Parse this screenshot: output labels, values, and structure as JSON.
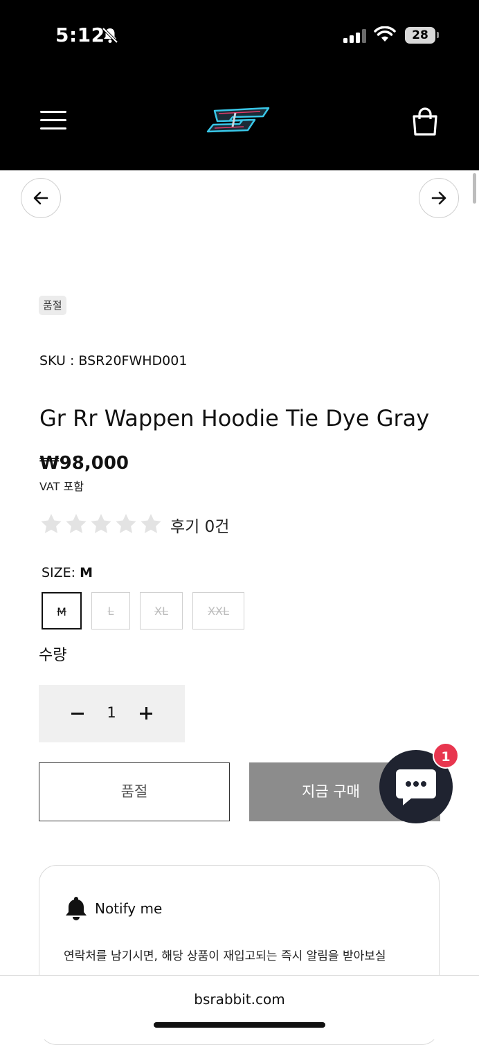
{
  "status_bar": {
    "time": "5:12",
    "battery": "28"
  },
  "product": {
    "badge": "품절",
    "sku": "SKU : BSR20FWHD001",
    "title": "Gr Rr Wappen Hoodie Tie Dye Gray",
    "price": "₩98,000",
    "vat": "VAT 포함",
    "rating": 0,
    "review_text": "후기 0건"
  },
  "size": {
    "label_prefix": "SIZE: ",
    "selected": "M",
    "options": [
      "M",
      "L",
      "XL",
      "XXL"
    ]
  },
  "quantity": {
    "label": "수량",
    "value": "1"
  },
  "buttons": {
    "soldout_label": "품절",
    "buy_now_label": "지금 구매"
  },
  "chat": {
    "badge_count": "1"
  },
  "notify": {
    "title": "Notify me",
    "text": "연락처를 남기시면, 해당 상품이 재입고되는 즉시 알림을 받아보실"
  },
  "browser": {
    "url": "bsrabbit.com"
  },
  "colors": {
    "header_bg": "#000000",
    "buy_button": "#8c8c8c",
    "chat_bg": "#1f2330",
    "chat_badge": "#e8364f",
    "star_empty": "#e3e3e3"
  }
}
